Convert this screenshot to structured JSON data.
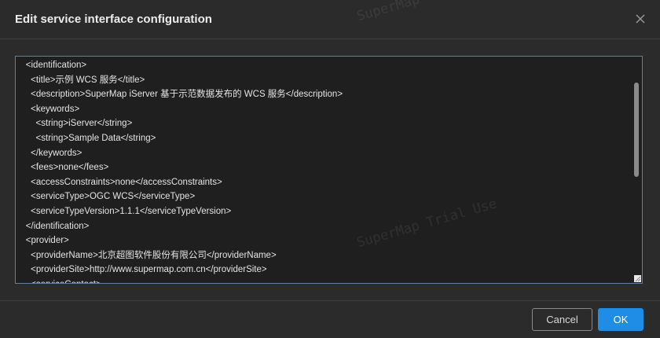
{
  "dialog": {
    "title": "Edit service interface configuration",
    "close_icon": "close-icon"
  },
  "editor": {
    "lines": [
      "    <identification>",
      "      <title>示例 WCS 服务</title>",
      "      <description>SuperMap iServer 基于示范数据发布的 WCS 服务</description>",
      "      <keywords>",
      "        <string>iServer</string>",
      "        <string>Sample Data</string>",
      "      </keywords>",
      "      <fees>none</fees>",
      "      <accessConstraints>none</accessConstraints>",
      "      <serviceType>OGC WCS</serviceType>",
      "      <serviceTypeVersion>1.1.1</serviceTypeVersion>",
      "    </identification>",
      "    <provider>",
      "      <providerName>北京超图软件股份有限公司</providerName>",
      "      <providerSite>http://www.supermap.com.cn</providerSite>",
      "      <serviceContact>"
    ]
  },
  "footer": {
    "cancel_label": "Cancel",
    "ok_label": "OK"
  },
  "watermarks": [
    "SuperMap Trial Use",
    "SuperMap"
  ],
  "colors": {
    "accent": "#1f8ce6",
    "background": "#2b2b2b",
    "editor_background": "#1f1f1f"
  }
}
